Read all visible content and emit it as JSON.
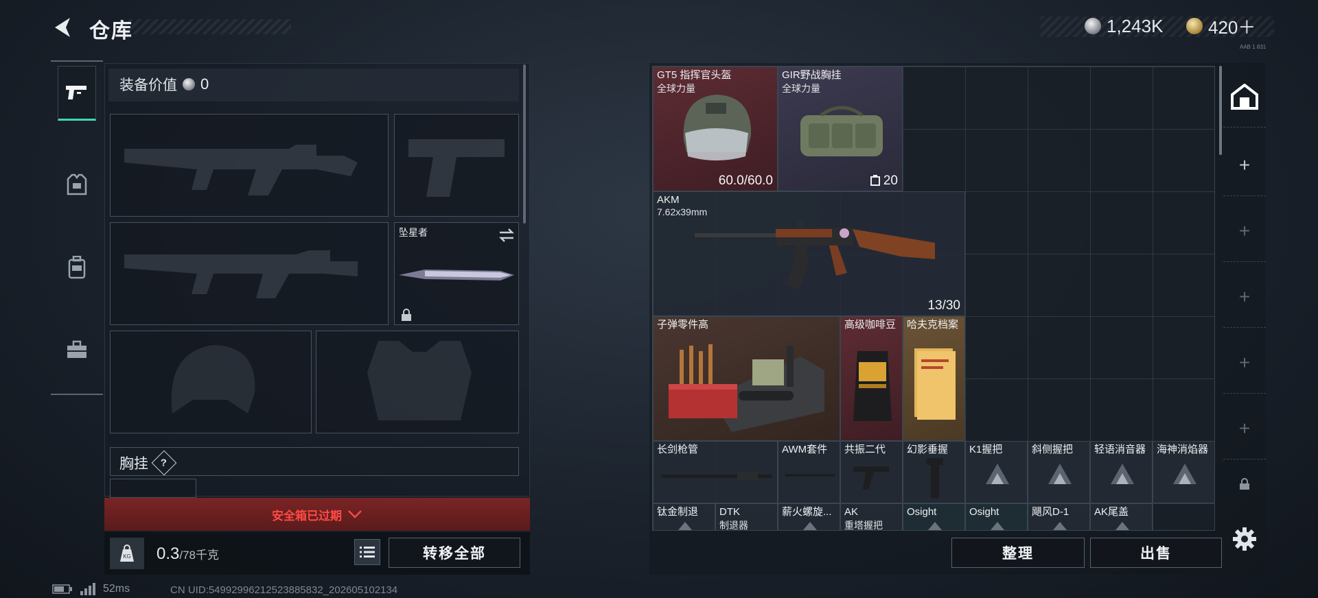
{
  "header": {
    "title": "仓库",
    "currency_silver": "1,243K",
    "currency_gold": "420＋",
    "corner_tag": "AAB 1 831"
  },
  "rail": {
    "items": [
      "weapons",
      "armor",
      "backpack",
      "toolbox"
    ]
  },
  "equipment": {
    "value_label": "装备价值",
    "value": "0",
    "melee_name": "坠星者",
    "chest_section": "胸挂",
    "help": "?"
  },
  "alert": {
    "text": "安全箱已过期"
  },
  "footer": {
    "weight": "0.3",
    "capacity": "/78千克",
    "transfer_all": "转移全部",
    "sort": "整理",
    "sell": "出售"
  },
  "colors": {
    "alert_red": "#ff4a45",
    "active_accent": "#3fd8b0"
  },
  "grid_items": [
    {
      "name": "GT5 指挥官头盔",
      "sub": "全球力量",
      "qty": "60.0/60.0"
    },
    {
      "name": "GIR野战胸挂",
      "sub": "全球力量",
      "qty": "20"
    },
    {
      "name": "AKM",
      "sub": "7.62x39mm",
      "qty": "13/30"
    },
    {
      "name": "子弹零件高",
      "sub": "",
      "qty": ""
    },
    {
      "name": "高级咖啡豆",
      "sub": "",
      "qty": ""
    },
    {
      "name": "哈夫克档案",
      "sub": "",
      "qty": ""
    },
    {
      "name": "长剑枪管",
      "sub": "",
      "qty": ""
    },
    {
      "name": "AWM套件",
      "sub": "",
      "qty": ""
    },
    {
      "name": "共振二代",
      "sub": "",
      "qty": ""
    },
    {
      "name": "幻影垂握",
      "sub": "",
      "qty": ""
    },
    {
      "name": "K1握把",
      "sub": "",
      "qty": ""
    },
    {
      "name": "斜侧握把",
      "sub": "",
      "qty": ""
    },
    {
      "name": "轻语消音器",
      "sub": "",
      "qty": ""
    },
    {
      "name": "海神消焰器",
      "sub": "",
      "qty": ""
    },
    {
      "name": "钛金制退",
      "sub": "",
      "qty": ""
    },
    {
      "name": "DTK",
      "sub": "制退器",
      "qty": ""
    },
    {
      "name": "薪火螺旋...",
      "sub": "",
      "qty": ""
    },
    {
      "name": "AK",
      "sub": "重塔握把",
      "qty": ""
    },
    {
      "name": "Osight",
      "sub": "",
      "qty": ""
    },
    {
      "name": "Osight",
      "sub": "",
      "qty": ""
    },
    {
      "name": "飓风D-1",
      "sub": "",
      "qty": ""
    },
    {
      "name": "AK尾盖",
      "sub": "",
      "qty": ""
    }
  ],
  "status": {
    "ping": "52ms",
    "uid": "CN UID:5499299621252388​5832_202605102134"
  }
}
